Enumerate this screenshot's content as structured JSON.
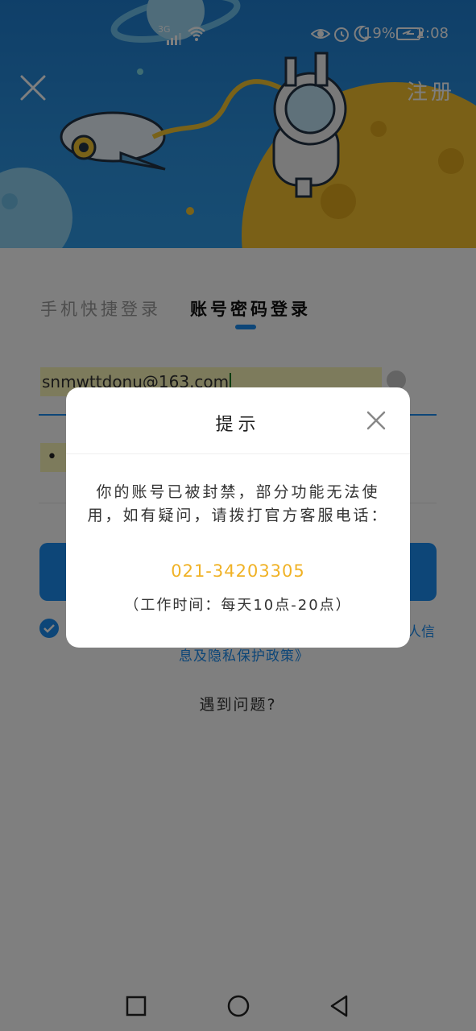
{
  "status_bar": {
    "network": "3G",
    "battery_percent": "19%",
    "time": "2:08"
  },
  "header": {
    "close_icon": "close-icon",
    "register_label": "注册"
  },
  "login": {
    "tabs": [
      {
        "label": "手机快捷登录",
        "active": false
      },
      {
        "label": "账号密码登录",
        "active": true
      }
    ],
    "email_value": "snmwttdonu@163.com",
    "password_value": "•",
    "agreement_fragment_right": "人信",
    "agreement_line2": "息及隐私保护政策》",
    "problem_link": "遇到问题?"
  },
  "dialog": {
    "title": "提示",
    "message": "你的账号已被封禁，部分功能无法使用，如有疑问，请拨打官方客服电话：",
    "phone": "021-34203305",
    "hours": "（工作时间：每天10点-20点）"
  },
  "colors": {
    "accent": "#1a8df0",
    "phone": "#f0b226",
    "autofill": "#fbf6b9"
  }
}
